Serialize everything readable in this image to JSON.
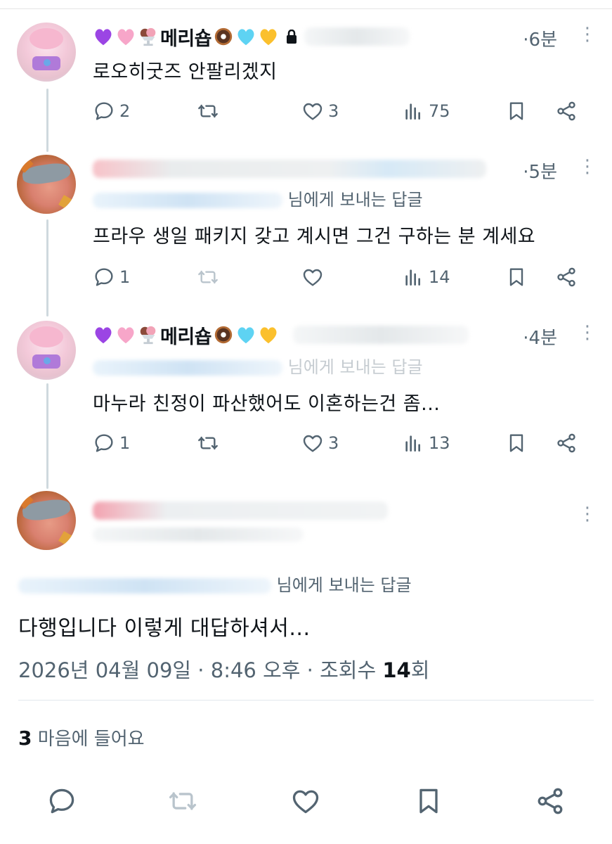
{
  "replies": [
    {
      "author_name": "메리숍",
      "time": "·6분",
      "text": "로오히굿즈 안팔리겠지",
      "stats": {
        "replies": "2",
        "retweets": "",
        "likes": "3",
        "views": "75"
      }
    },
    {
      "author_name": "",
      "time": "·5분",
      "reply_to": "님에게 보내는 답글",
      "text": "프라우 생일 패키지 갖고 계시면 그건 구하는 분 계세요",
      "stats": {
        "replies": "1",
        "retweets": "",
        "likes": "",
        "views": "14"
      }
    },
    {
      "author_name": "메리숍",
      "time": "·4분",
      "reply_to": "님에게 보내는 답글",
      "text": "마누라 친정이 파산했어도 이혼하는건 좀...",
      "stats": {
        "replies": "1",
        "retweets": "",
        "likes": "3",
        "views": "13"
      }
    }
  ],
  "main_tweet": {
    "reply_to": "님에게 보내는 답글",
    "text": "다행입니다 이렇게 대답하셔서...",
    "date": "2026년 04월 09일 · 8:46 오후 · 조회수",
    "views_count": "14",
    "views_unit": "회",
    "likes_count": "3",
    "likes_label": "마음에 들어요"
  },
  "icons": {
    "reply": "reply-icon",
    "retweet": "retweet-icon",
    "like": "heart-icon",
    "views": "views-icon",
    "bookmark": "bookmark-icon",
    "share": "share-icon",
    "more": "more-icon",
    "lock": "lock-icon"
  },
  "colors": {
    "text": "#0f1419",
    "secondary": "#536471",
    "thread_line": "#cfd9de",
    "icon_muted": "#b9c4cc"
  }
}
